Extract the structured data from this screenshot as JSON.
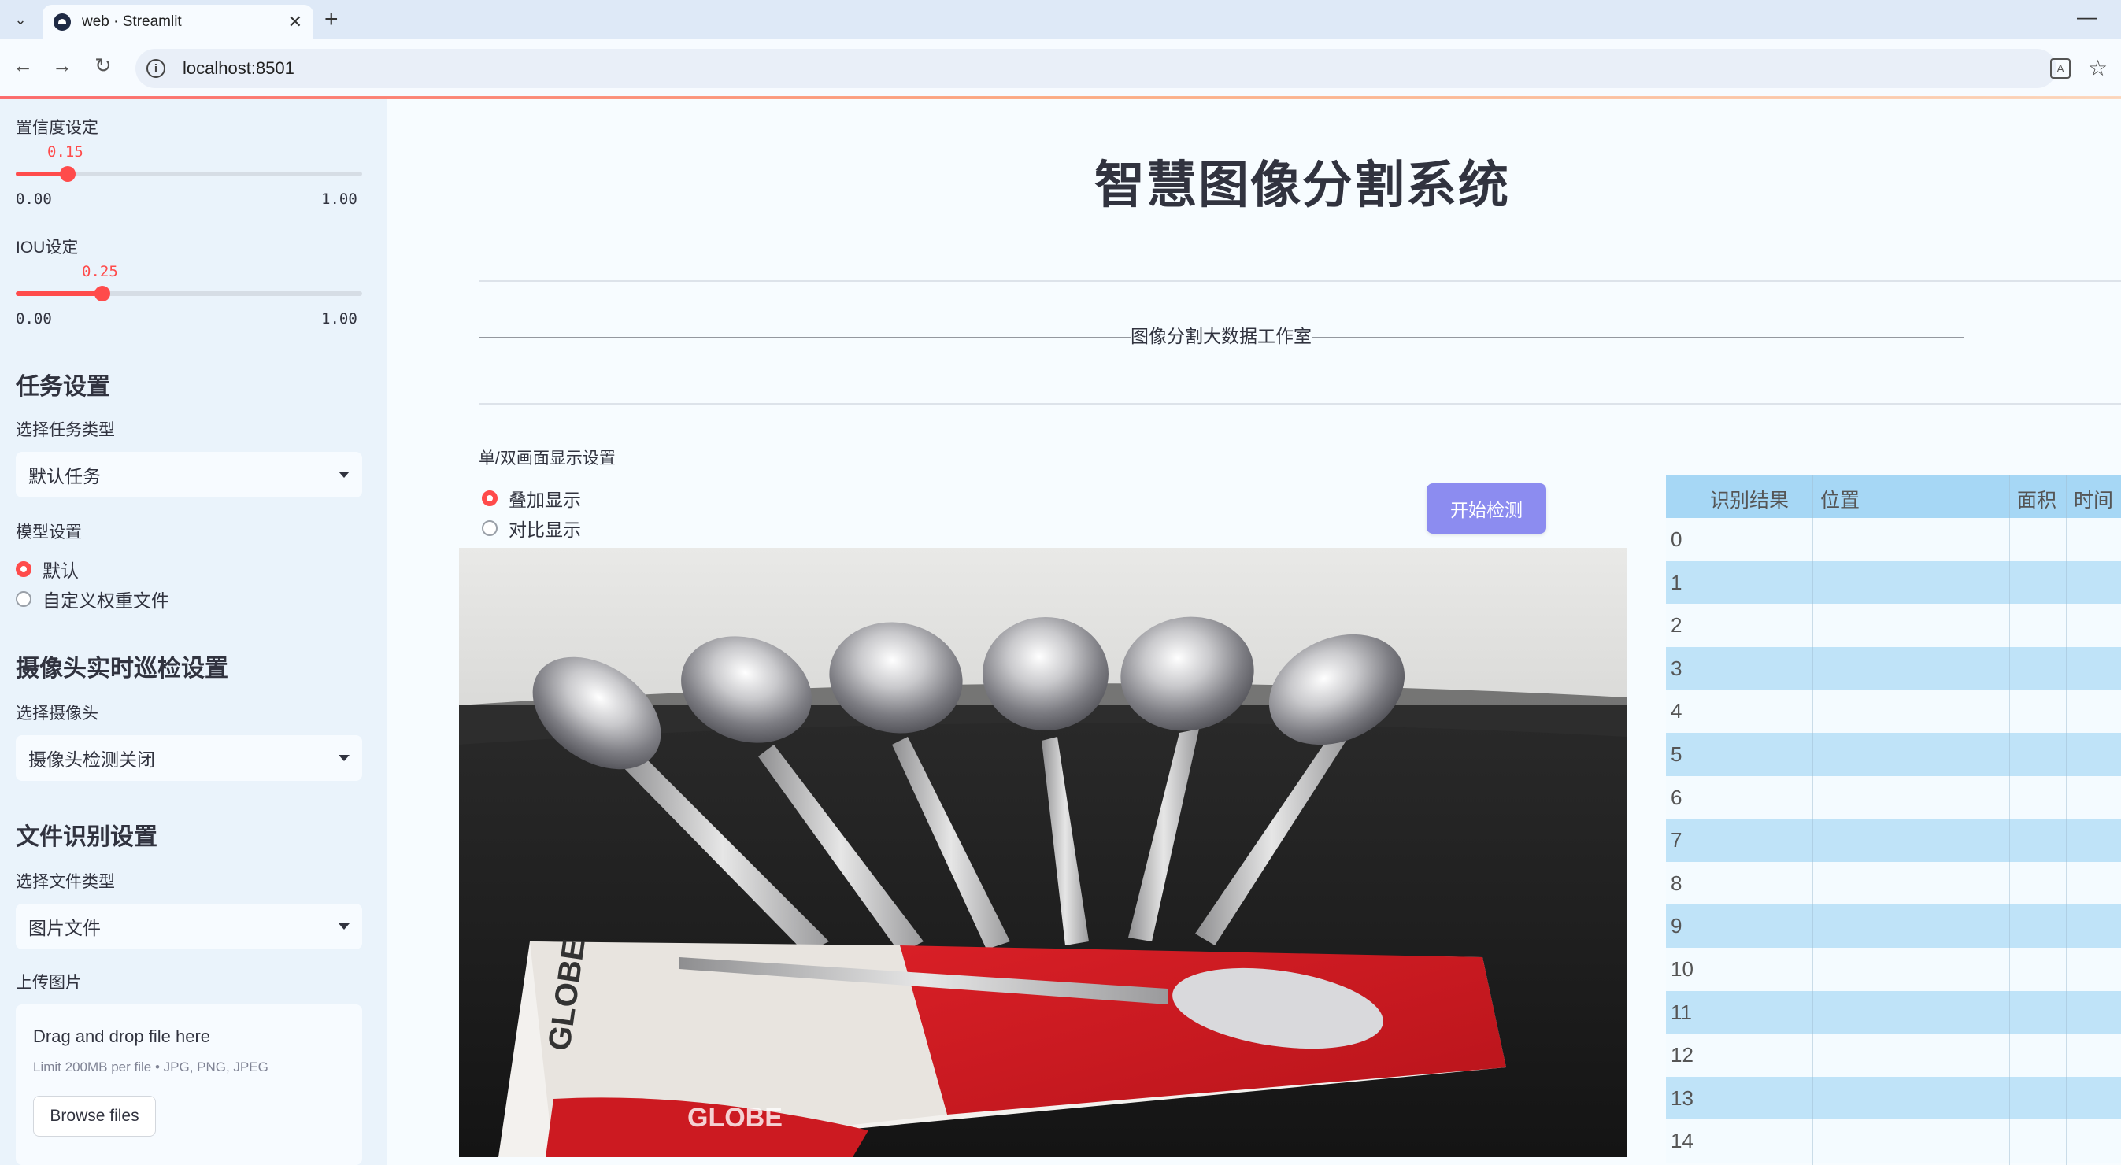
{
  "browser": {
    "tab_title": "web · Streamlit",
    "url": "localhost:8501"
  },
  "sidebar": {
    "confidence": {
      "label": "置信度设定",
      "value": "0.15",
      "min": "0.00",
      "max": "1.00",
      "fraction": 0.15
    },
    "iou": {
      "label": "IOU设定",
      "value": "0.25",
      "min": "0.00",
      "max": "1.00",
      "fraction": 0.25
    },
    "task_heading": "任务设置",
    "task_type_label": "选择任务类型",
    "task_type_value": "默认任务",
    "model_label": "模型设置",
    "model_options": [
      "默认",
      "自定义权重文件"
    ],
    "model_selected": 0,
    "camera_heading": "摄像头实时巡检设置",
    "camera_label": "选择摄像头",
    "camera_value": "摄像头检测关闭",
    "file_heading": "文件识别设置",
    "file_type_label": "选择文件类型",
    "file_type_value": "图片文件",
    "upload_label": "上传图片",
    "upload_title": "Drag and drop file here",
    "upload_sub": "Limit 200MB per file • JPG, PNG, JPEG",
    "browse_label": "Browse files"
  },
  "main": {
    "title": "智慧图像分割系统",
    "subtitle_line": "————————————————————————————————————图像分割大数据工作室————————————————————————————————————",
    "display_label": "单/双画面显示设置",
    "display_options": [
      "叠加显示",
      "对比显示"
    ],
    "display_selected": 0,
    "start_button": "开始检测"
  },
  "table": {
    "columns": [
      "识别结果",
      "位置",
      "面积",
      "时间"
    ],
    "rows": [
      "0",
      "1",
      "2",
      "3",
      "4",
      "5",
      "6",
      "7",
      "8",
      "9",
      "10",
      "11",
      "12",
      "13",
      "14"
    ]
  },
  "colors": {
    "accent": "#ff4b4b",
    "button": "#8c8cf0",
    "table_header": "#a6d7f5",
    "table_stripe": "#bfe3f8"
  }
}
